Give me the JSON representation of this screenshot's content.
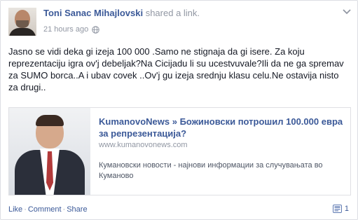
{
  "post": {
    "author_name": "Toni Sanac Mihajlovski",
    "action": "shared a link.",
    "timestamp": "21 hours ago",
    "text": "Jasno se vidi deka gi izeja 100 000 .Samo ne stignaja da gi isere. Za koju reprezentaciju igra ov'j debeljak?Na Cicijadu li su ucestvuvale?Ili da ne ga spremav za SUMO borca..A i ubav covek ..Ov'j gu izeja srednju klasu celu.Ne ostavija nisto za drugi.."
  },
  "attachment": {
    "title": "KumanovoNews » Божиновски потрошил 100.000 евра за репрезентација?",
    "url": "www.kumanovonews.com",
    "description": "Кумановски новости - најнови информации за случувањата во Куманово"
  },
  "actions": {
    "like": "Like",
    "comment": "Comment",
    "share": "Share",
    "separator": "·"
  },
  "share_count": "1",
  "icons": {
    "globe": "globe-icon",
    "chevron": "chevron-down-icon",
    "share": "share-icon"
  },
  "colors": {
    "link_blue": "#3b5998",
    "meta_gray": "#9197a3"
  }
}
